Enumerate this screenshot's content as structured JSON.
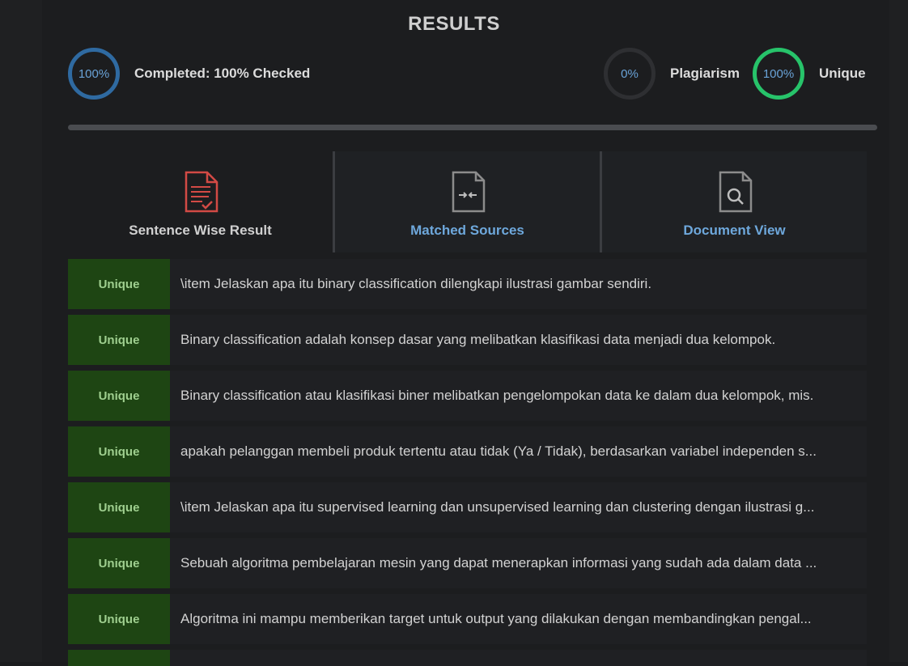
{
  "header": {
    "title": "RESULTS"
  },
  "stats": {
    "completed": {
      "ring": "100%",
      "label": "Completed: 100% Checked",
      "value": 100
    },
    "plagiarism": {
      "ring": "0%",
      "label": "Plagiarism",
      "value": 0
    },
    "unique": {
      "ring": "100%",
      "label": "Unique",
      "value": 100
    }
  },
  "tabs": [
    {
      "label": "Sentence Wise Result",
      "icon": "report-icon",
      "active": true
    },
    {
      "label": "Matched Sources",
      "icon": "compare-icon",
      "active": false
    },
    {
      "label": "Document View",
      "icon": "document-search-icon",
      "active": false
    }
  ],
  "results": [
    {
      "status": "Unique",
      "text": "\\item Jelaskan apa itu binary classification dilengkapi ilustrasi gambar sendiri."
    },
    {
      "status": "Unique",
      "text": "Binary classification adalah konsep dasar yang melibatkan klasifikasi data menjadi dua kelompok."
    },
    {
      "status": "Unique",
      "text": "Binary classification atau klasifikasi biner melibatkan pengelompokan data ke dalam dua kelompok, mis."
    },
    {
      "status": "Unique",
      "text": "apakah pelanggan membeli produk tertentu atau tidak (Ya / Tidak), berdasarkan variabel independen s..."
    },
    {
      "status": "Unique",
      "text": "\\item Jelaskan apa itu supervised learning dan unsupervised learning dan clustering dengan ilustrasi g..."
    },
    {
      "status": "Unique",
      "text": "Sebuah algoritma pembelajaran mesin yang dapat menerapkan informasi yang sudah ada dalam data ..."
    },
    {
      "status": "Unique",
      "text": "Algoritma ini mampu memberikan target untuk output yang dilakukan dengan membandingkan pengal..."
    }
  ],
  "colors": {
    "completed_ring": "#2f6aa1",
    "unique_ring": "#27c36a",
    "badge_bg": "#1e4513",
    "badge_text": "#9fcf8f",
    "tab_link": "#6ea8dc",
    "report_icon": "#d24a45"
  }
}
